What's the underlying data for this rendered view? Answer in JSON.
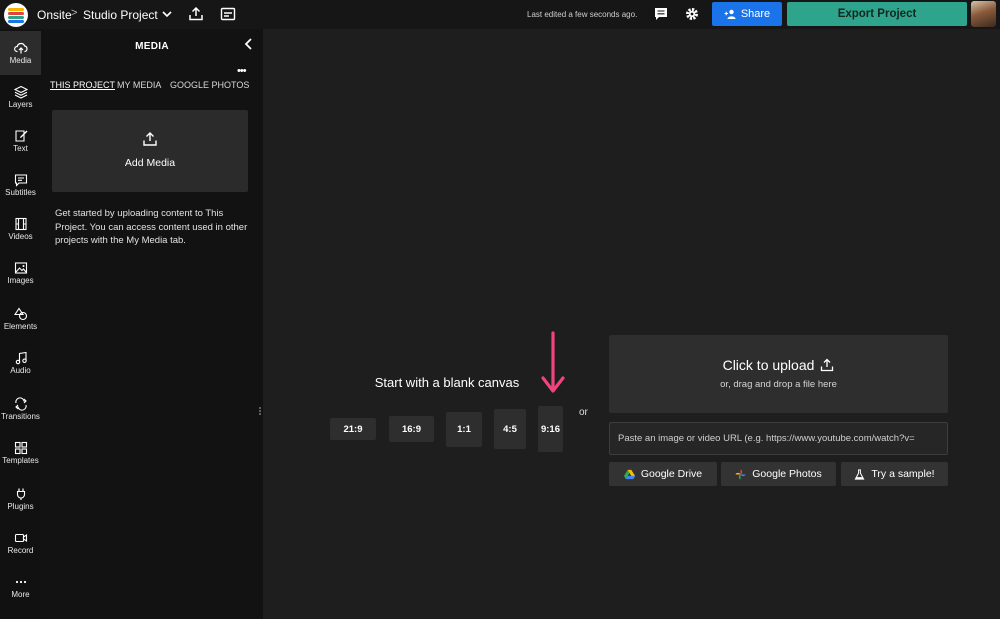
{
  "header": {
    "workspace": "Onsite",
    "separator": ">",
    "project_name": "Studio Project",
    "last_edited": "Last edited a few seconds ago.",
    "share_label": "Share",
    "export_label": "Export Project"
  },
  "colors": {
    "share": "#1a73e8",
    "export": "#2fa48d",
    "arrow": "#f0457c"
  },
  "rail": {
    "items": [
      {
        "label": "Media",
        "icon": "cloud-upload-icon"
      },
      {
        "label": "Layers",
        "icon": "layers-icon"
      },
      {
        "label": "Text",
        "icon": "text-icon"
      },
      {
        "label": "Subtitles",
        "icon": "subtitles-icon"
      },
      {
        "label": "Videos",
        "icon": "film-icon"
      },
      {
        "label": "Images",
        "icon": "image-icon"
      },
      {
        "label": "Elements",
        "icon": "shapes-icon"
      },
      {
        "label": "Audio",
        "icon": "music-note-icon"
      },
      {
        "label": "Transitions",
        "icon": "transition-icon"
      },
      {
        "label": "Templates",
        "icon": "grid-icon"
      },
      {
        "label": "Plugins",
        "icon": "plug-icon"
      },
      {
        "label": "Record",
        "icon": "video-camera-icon"
      },
      {
        "label": "More",
        "icon": "more-dots-icon"
      }
    ]
  },
  "media_panel": {
    "title": "MEDIA",
    "more": "•••",
    "tabs": [
      "THIS PROJECT",
      "MY MEDIA",
      "GOOGLE PHOTOS"
    ],
    "add_media_label": "Add Media",
    "help_text": "Get started by uploading content to This Project. You can access content used in other projects with the My Media tab."
  },
  "canvas": {
    "blank_title": "Start with a blank canvas",
    "ratios": [
      "21:9",
      "16:9",
      "1:1",
      "4:5",
      "9:16"
    ],
    "or_label": "or"
  },
  "upload": {
    "title": "Click to upload",
    "subtitle": "or, drag and drop a file here",
    "url_placeholder": "Paste an image or video URL (e.g. https://www.youtube.com/watch?v=",
    "google_drive": "Google Drive",
    "google_photos": "Google Photos",
    "try_sample": "Try a sample!"
  }
}
